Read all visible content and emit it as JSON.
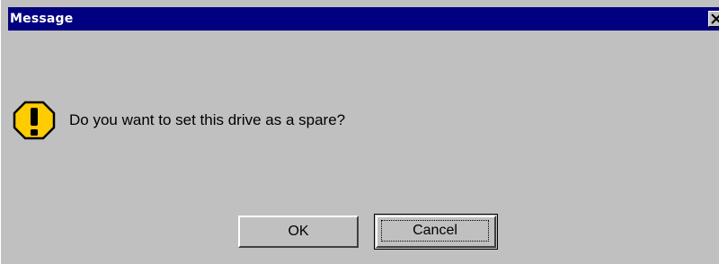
{
  "window": {
    "title": "Message",
    "close_icon": "close-icon"
  },
  "dialog": {
    "icon": "warning-icon",
    "message": "Do you want to set this drive as a spare?",
    "ok_label": "OK",
    "cancel_label": "Cancel"
  },
  "colors": {
    "titlebar": "#000080",
    "face": "#c0c0c0",
    "warning": "#ffcc00"
  }
}
